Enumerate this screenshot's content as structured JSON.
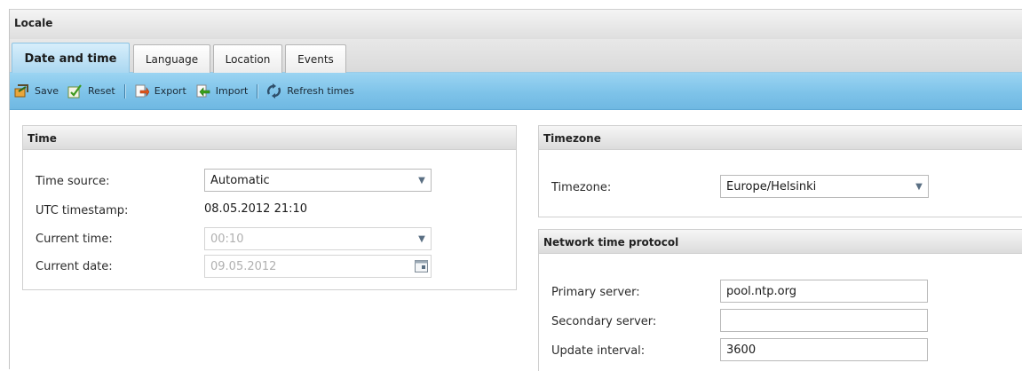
{
  "panel": {
    "title": "Locale"
  },
  "tabs": [
    {
      "label": "Date and time",
      "active": true
    },
    {
      "label": "Language",
      "active": false
    },
    {
      "label": "Location",
      "active": false
    },
    {
      "label": "Events",
      "active": false
    }
  ],
  "toolbar": {
    "save_label": "Save",
    "reset_label": "Reset",
    "export_label": "Export",
    "import_label": "Import",
    "refresh_label": "Refresh times",
    "icons": [
      "save-icon",
      "reset-icon",
      "export-icon",
      "import-icon",
      "refresh-icon"
    ]
  },
  "time": {
    "title": "Time",
    "source_label": "Time source:",
    "source_value": "Automatic",
    "utc_label": "UTC timestamp:",
    "utc_value": "08.05.2012 21:10",
    "current_time_label": "Current time:",
    "current_time_value": "00:10",
    "current_date_label": "Current date:",
    "current_date_value": "09.05.2012"
  },
  "timezone": {
    "title": "Timezone",
    "label": "Timezone:",
    "value": "Europe/Helsinki"
  },
  "ntp": {
    "title": "Network time protocol",
    "primary_label": "Primary server:",
    "primary_value": "pool.ntp.org",
    "secondary_label": "Secondary server:",
    "secondary_value": "",
    "interval_label": "Update interval:",
    "interval_value": "3600"
  },
  "colors": {
    "toolbar_blue": "#7ec3e9",
    "active_tab": "#a8d6f0",
    "header_grey": "#dedede"
  }
}
